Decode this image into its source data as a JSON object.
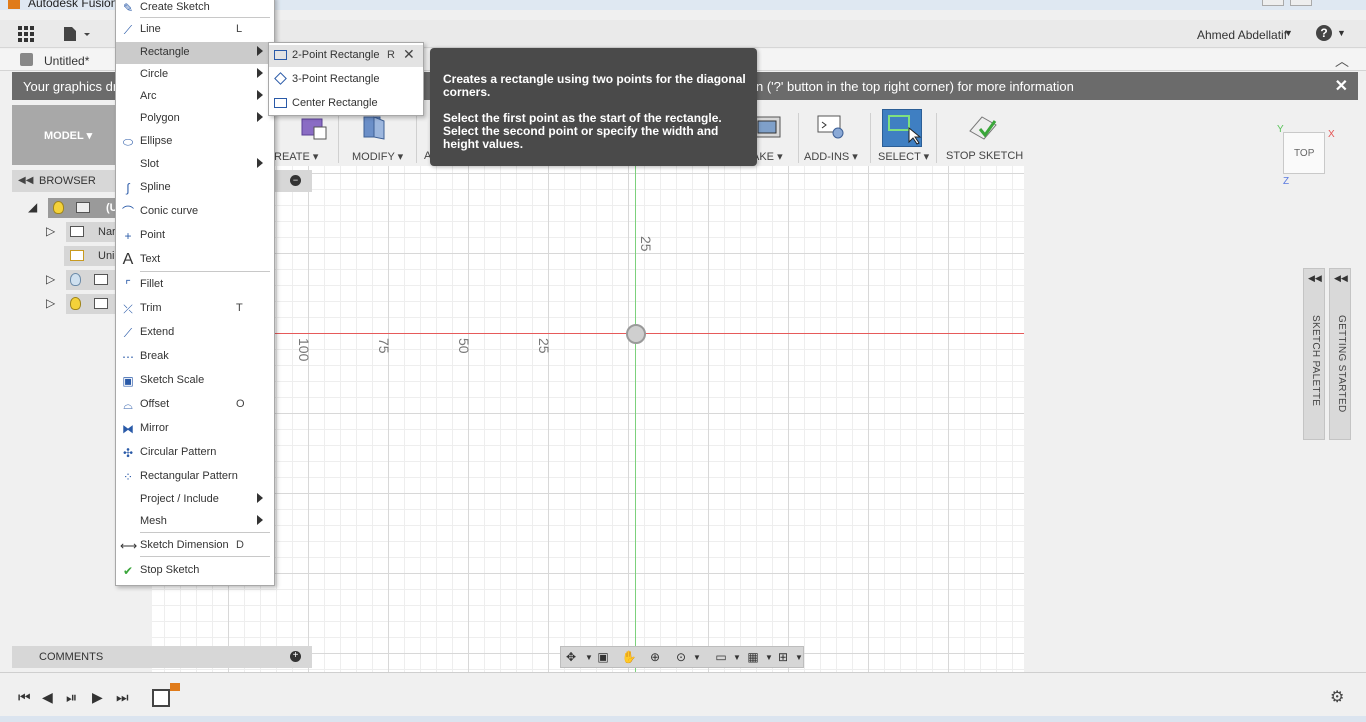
{
  "window": {
    "title": "Autodesk Fusion"
  },
  "toolbar": {
    "user_name": "Ahmed Abdellatif",
    "help_label": "?"
  },
  "document": {
    "tab_label": "Untitled*"
  },
  "banner": {
    "text_left": "Your graphics dr",
    "text_right": "n ('?' button in the top right corner) for more information",
    "close": "✕"
  },
  "ribbon": {
    "workspace": "MODEL ▾",
    "create": "REATE ▾",
    "modify": "MODIFY ▾",
    "inspect": "A",
    "make": "AKE ▾",
    "addins": "ADD-INS ▾",
    "select": "SELECT ▾",
    "stop_sketch": "STOP SKETCH"
  },
  "browser": {
    "title": "BROWSER",
    "items": [
      {
        "label": "(U"
      },
      {
        "label": "Nar"
      },
      {
        "label": "Uni"
      },
      {
        "label": ""
      },
      {
        "label": ""
      }
    ]
  },
  "comments": {
    "title": "COMMENTS"
  },
  "canvas": {
    "ruler_x": [
      "100",
      "75",
      "50",
      "25"
    ],
    "ruler_y": [
      "25"
    ]
  },
  "palettes": {
    "sketch_palette": "SKETCH PALETTE",
    "getting_started": "GETTING STARTED"
  },
  "viewcube": {
    "face": "TOP",
    "x": "X",
    "y": "Y",
    "z": "Z"
  },
  "create_menu": {
    "items": [
      {
        "label": "Create Sketch",
        "key": ""
      },
      {
        "label": "Line",
        "key": "L"
      },
      {
        "label": "Rectangle",
        "key": ""
      },
      {
        "label": "Circle",
        "key": ""
      },
      {
        "label": "Arc",
        "key": ""
      },
      {
        "label": "Polygon",
        "key": ""
      },
      {
        "label": "Ellipse",
        "key": ""
      },
      {
        "label": "Slot",
        "key": ""
      },
      {
        "label": "Spline",
        "key": ""
      },
      {
        "label": "Conic curve",
        "key": ""
      },
      {
        "label": "Point",
        "key": ""
      },
      {
        "label": "Text",
        "key": ""
      },
      {
        "label": "Fillet",
        "key": ""
      },
      {
        "label": "Trim",
        "key": "T"
      },
      {
        "label": "Extend",
        "key": ""
      },
      {
        "label": "Break",
        "key": ""
      },
      {
        "label": "Sketch Scale",
        "key": ""
      },
      {
        "label": "Offset",
        "key": "O"
      },
      {
        "label": "Mirror",
        "key": ""
      },
      {
        "label": "Circular Pattern",
        "key": ""
      },
      {
        "label": "Rectangular Pattern",
        "key": ""
      },
      {
        "label": "Project / Include",
        "key": ""
      },
      {
        "label": "Mesh",
        "key": ""
      },
      {
        "label": "Sketch Dimension",
        "key": "D"
      },
      {
        "label": "Stop Sketch",
        "key": ""
      }
    ]
  },
  "rectangle_submenu": {
    "items": [
      {
        "label": "2-Point Rectangle",
        "key": "R"
      },
      {
        "label": "3-Point Rectangle",
        "key": ""
      },
      {
        "label": "Center Rectangle",
        "key": ""
      }
    ]
  },
  "tooltip": {
    "title": "Creates a rectangle using two points for the diagonal corners.",
    "body": "Select the first point as the start of the rectangle. Select the second point or specify the width and height values."
  }
}
